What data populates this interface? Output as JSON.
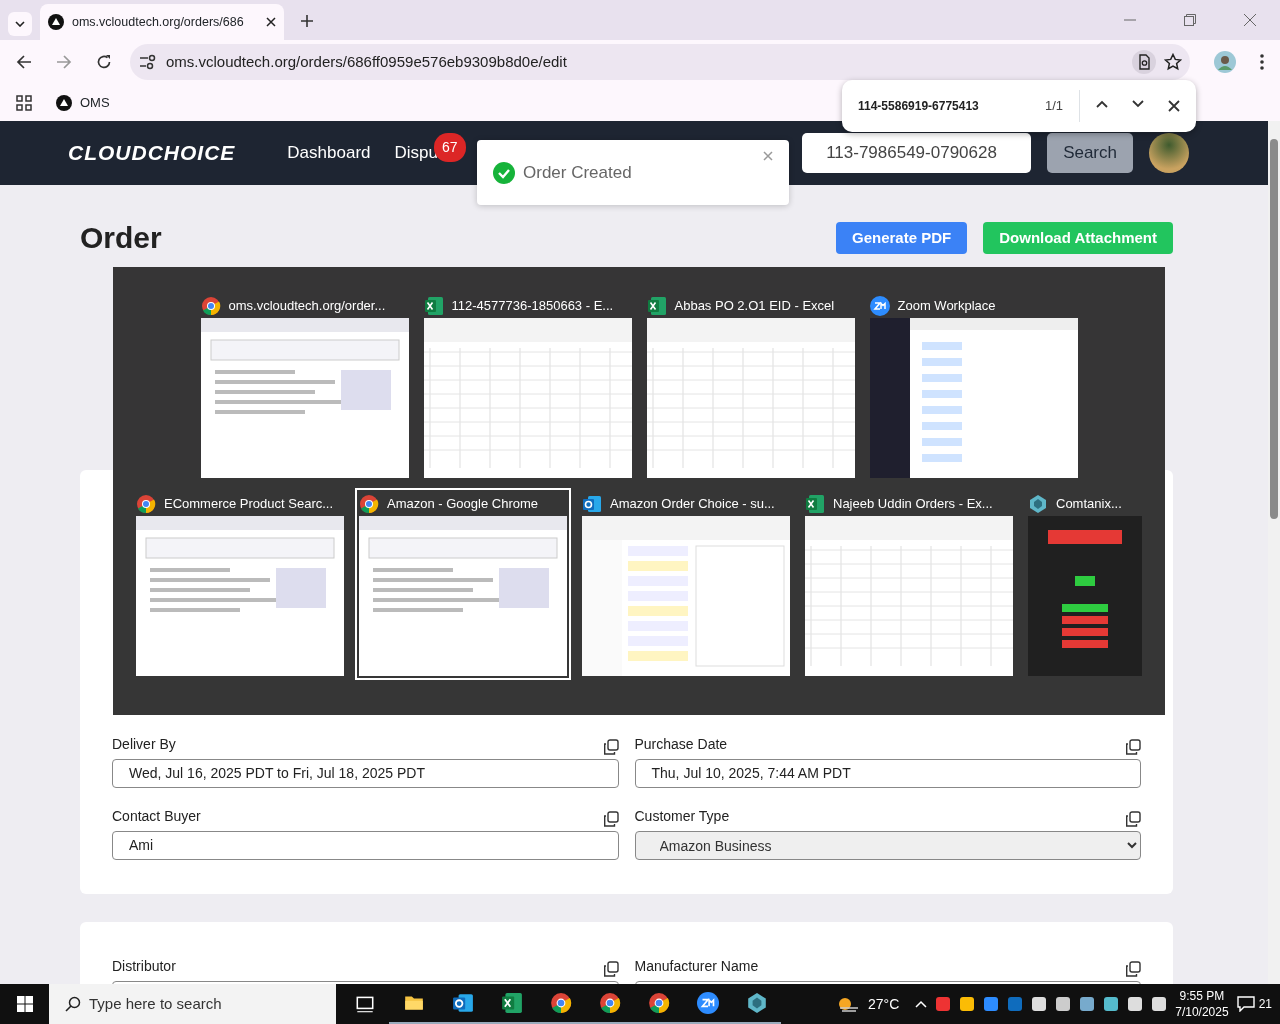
{
  "browser": {
    "tabs": [
      {
        "title": "oms.vcloudtech.org/orders/686",
        "selected": true
      }
    ],
    "address": "oms.vcloudtech.org/orders/686ff0959e576eb9309b8d0e/edit",
    "bookmarks": [
      "OMS"
    ]
  },
  "find_bar": {
    "query": "114-5586919-6775413",
    "count": "1/1"
  },
  "navbar": {
    "logo": "CLOUDCHOICE",
    "links": [
      {
        "label": "Dashboard"
      },
      {
        "label": "Dispu",
        "badge": "67"
      }
    ],
    "search_value": "113-7986549-0790628",
    "search_button": "Search"
  },
  "toast": {
    "message": "Order Created"
  },
  "page": {
    "title": "Order",
    "buttons": [
      {
        "label": "Generate PDF",
        "kind": "primary"
      },
      {
        "label": "Download Attachment",
        "kind": "success"
      }
    ]
  },
  "fields": [
    {
      "label": "Deliver By",
      "value": "Wed, Jul 16, 2025 PDT to Fri, Jul 18, 2025 PDT",
      "kind": "input"
    },
    {
      "label": "Purchase Date",
      "value": "Thu, Jul 10, 2025, 7:44 AM PDT",
      "kind": "input"
    },
    {
      "label": "Contact Buyer",
      "value": "Ami",
      "kind": "input"
    },
    {
      "label": "Customer Type",
      "value": "Amazon Business",
      "kind": "select"
    }
  ],
  "more_fields": [
    {
      "label": "Distributor"
    },
    {
      "label": "Manufacturer Name"
    }
  ],
  "task_switcher": {
    "rows": [
      [
        {
          "title": "oms.vcloudtech.org/order...",
          "kind": "chrome",
          "selected": false
        },
        {
          "title": "112-4577736-1850663 - E...",
          "kind": "excel",
          "selected": false
        },
        {
          "title": "Abbas PO 2.O1  EID - Excel",
          "kind": "excel",
          "selected": false
        },
        {
          "title": "Zoom Workplace",
          "kind": "zoom",
          "selected": false
        }
      ],
      [
        {
          "title": "ECommerce Product Searc...",
          "kind": "chrome",
          "selected": false
        },
        {
          "title": "Amazon - Google Chrome",
          "kind": "chrome",
          "selected": true
        },
        {
          "title": "Amazon Order Choice - su...",
          "kind": "outlook",
          "selected": false
        },
        {
          "title": "Najeeb Uddin Orders - Ex...",
          "kind": "excel",
          "selected": false
        },
        {
          "title": "Comtanix...",
          "kind": "comtanix",
          "selected": false
        }
      ]
    ]
  },
  "taskbar": {
    "search_placeholder": "Type here to search",
    "temperature": "27°C",
    "time": "9:55 PM",
    "date": "7/10/2025",
    "notifications": "21"
  }
}
